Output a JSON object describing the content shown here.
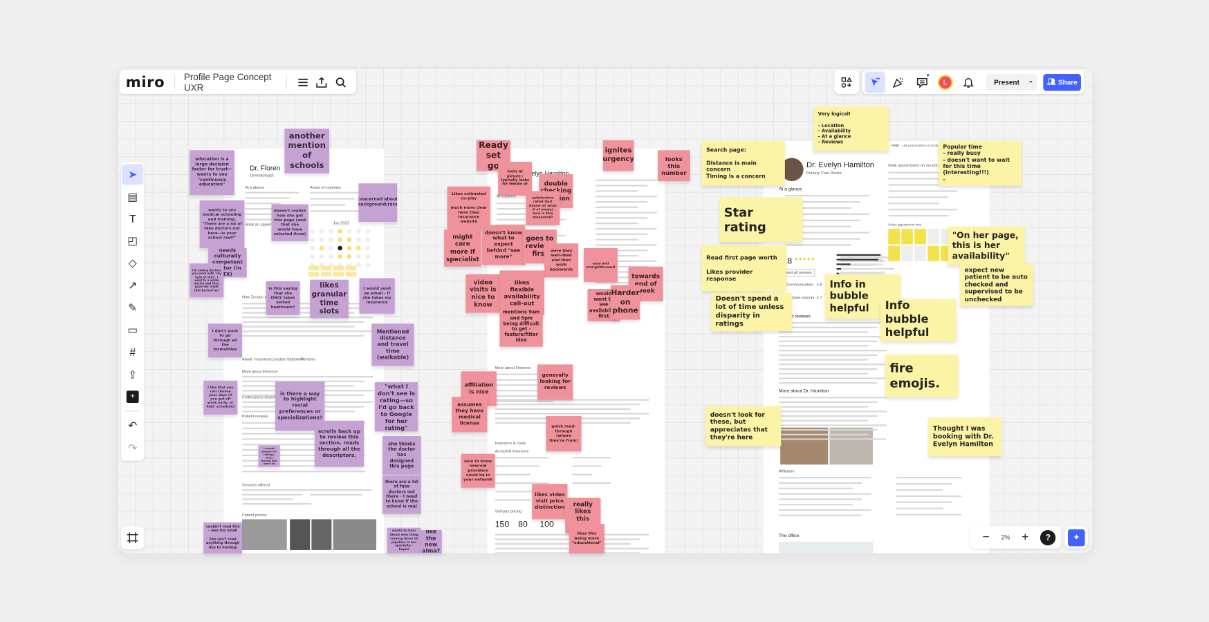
{
  "app": {
    "logo": "miro",
    "board_title": "Profile Page Concept UXR"
  },
  "top_right": {
    "present_label": "Present",
    "share_label": "Share",
    "avatar_initial": "L",
    "accent": "#4262ff",
    "avatar_color": "#f24e5b"
  },
  "zoom": {
    "level": "2%",
    "minus": "−",
    "plus": "+",
    "help": "?"
  },
  "left_tools": [
    "select-icon",
    "templates-icon",
    "text-icon",
    "sticky-note-icon",
    "shapes-icon",
    "arrow-icon",
    "pen-icon",
    "comment-icon",
    "frame-icon",
    "upload-icon",
    "add-icon",
    "undo-icon",
    "redo-icon"
  ],
  "colors": {
    "purple_sticky": "#c6a2d4",
    "pink_sticky": "#ef929b",
    "yellow_sticky": "#fbf3a5"
  },
  "mockups": {
    "page1": {
      "name": "Dr. Floren",
      "specialty": "Dermatologist",
      "sections": [
        "At a glance",
        "Areas of expertise",
        "Book an appointment",
        "How Zocdoc works",
        "More about Florence",
        "Professional statement",
        "Patient reviews",
        "Services offered",
        "Patient photos"
      ],
      "tabs": [
        "About",
        "Insurance",
        "Location",
        "Statement",
        "Reviews"
      ],
      "calendar_month": "Jun 2023"
    },
    "page2": {
      "name": "Evelyn Hamilton",
      "sections": [
        "At a glance",
        "More about Florence",
        "Insurance & costs",
        "Accepted insurance",
        "Self-pay pricing"
      ],
      "prices": [
        "150",
        "80",
        "100"
      ]
    },
    "page3": {
      "name": "Dr. Evelyn Hamilton",
      "specialty": "Primary Care Doctor",
      "at_a_glance": "At a glance",
      "book": "Book appointment on Zocdoc",
      "rating": "4.8",
      "read_reviews": "Read all reviews",
      "communication": "Communication",
      "communication_score": "4.8",
      "bedside": "Bedside manner",
      "bedside_score": "4.7",
      "recent_reviews": "Recent reviews",
      "more_about": "More about Dr. Hamilton",
      "affiliation": "Affiliation",
      "office": "The office",
      "help": "Help",
      "list_practice": "List your practice on Zocdoc",
      "select_time": "Select appointment time"
    }
  },
  "stickies": [
    {
      "color": "purple",
      "text": "education is a large decision factor for trust—wants to see \"continuous education\""
    },
    {
      "color": "purple",
      "text": "another mention of schools"
    },
    {
      "color": "purple",
      "text": "concerned about background/race"
    },
    {
      "color": "purple",
      "text": "wants to see medical schooling and training. \"There are a lot of fake doctors out here—is your school real?\""
    },
    {
      "color": "purple",
      "text": "doesn't realize how she got this page (and that she would have selected Acne)"
    },
    {
      "color": "purple",
      "text": "needs culturally competent doctor (in TX)"
    },
    {
      "color": "purple",
      "text": "I'm seeing doctors you work with \"my type of skin\". I went to a white doctor and they gave her made that burned her"
    },
    {
      "color": "purple",
      "text": "is this saying that she ONLY takes united heathcare?"
    },
    {
      "color": "purple",
      "text": "likes granular time slots"
    },
    {
      "color": "purple",
      "text": "I would send an email - if she takes my insurance"
    },
    {
      "color": "purple",
      "text": "I don't want to go through all the formalities"
    },
    {
      "color": "purple",
      "text": "Mentioned distance and travel time (walkable)"
    },
    {
      "color": "purple",
      "text": "I like that you can choose your days (if you get off work early, or kids' schedule)"
    },
    {
      "color": "purple",
      "text": "is there a way to highlight racial preferences or specializations?"
    },
    {
      "color": "purple",
      "text": "scrolls back up to review this section. reads through all the descriptors."
    },
    {
      "color": "purple",
      "text": "\"what I don't see is rating—so I'd go back to Google for her rating\""
    },
    {
      "color": "purple",
      "text": "I would google for ratings, what school she went to"
    },
    {
      "color": "purple",
      "text": "she thinks the doctor has designed this page"
    },
    {
      "color": "purple",
      "text": "there are a lot of fake doctors out there - I need to know if the school is real"
    },
    {
      "color": "purple",
      "text": "couldn't read this - was too small\n\nshe can't read anything through due to mockup"
    },
    {
      "color": "purple",
      "text": "wants to hear about new thing coming down th pipeline in her specialty - hopes"
    },
    {
      "color": "purple",
      "text": "like the new alma?"
    },
    {
      "color": "pink",
      "text": "Ready set go"
    },
    {
      "color": "pink",
      "text": "looks at picture / typically looks for female dr"
    },
    {
      "color": "pink",
      "text": "double checking location"
    },
    {
      "color": "pink",
      "text": "satisfaction rated (but based on what # of views) how is this measured?"
    },
    {
      "color": "pink",
      "text": "Likes estimated co-play\n\nmuch more clear here than insurance website"
    },
    {
      "color": "pink",
      "text": "ignites urgency"
    },
    {
      "color": "pink",
      "text": "looks this number"
    },
    {
      "color": "pink",
      "text": "might care more if specialist"
    },
    {
      "color": "pink",
      "text": "doesn't know what to expect behind \"see more\""
    },
    {
      "color": "pink",
      "text": "goes to reviews first"
    },
    {
      "color": "pink",
      "text": "were they well-liked and then work backwards"
    },
    {
      "color": "pink",
      "text": "easy and straightforward"
    },
    {
      "color": "pink",
      "text": "towards end of week"
    },
    {
      "color": "pink",
      "text": "video visits is nice to know"
    },
    {
      "color": "pink",
      "text": "likes flexible availability call-out"
    },
    {
      "color": "pink",
      "text": "would want to see availability first"
    },
    {
      "color": "pink",
      "text": "Harder on phone"
    },
    {
      "color": "pink",
      "text": "mentions 9am and 5pm being difficult to get - feature/filter idea"
    },
    {
      "color": "pink",
      "text": "affiliation is nice"
    },
    {
      "color": "pink",
      "text": "assumes they have medical license"
    },
    {
      "color": "pink",
      "text": "generally looking for reviews"
    },
    {
      "color": "pink",
      "text": "quick read-through (where they're from)"
    },
    {
      "color": "pink",
      "text": "nice to know new/old providers could be in your network"
    },
    {
      "color": "pink",
      "text": "likes video visit price distinction"
    },
    {
      "color": "pink",
      "text": "really likes this section"
    },
    {
      "color": "pink",
      "text": "likes this being more \"educational\""
    },
    {
      "color": "yellow",
      "text": "Very logical!\n\n- Location\n- Availability\n- At a glance\n- Reviews"
    },
    {
      "color": "yellow",
      "text": "Search page:\n\nDistance is main concern\nTiming is a concern"
    },
    {
      "color": "yellow",
      "text": "Popular time\n- really busy\n- doesn't want to wait for this time (interesting!!!)\n-"
    },
    {
      "color": "yellow",
      "text": "Star rating"
    },
    {
      "color": "yellow",
      "text": "Read first page worth\n\nLikes provider response"
    },
    {
      "color": "yellow",
      "text": "Doesn't spend a lot of time unless disparity in ratings"
    },
    {
      "color": "yellow",
      "text": "\"On her page, this is her availability\""
    },
    {
      "color": "yellow",
      "text": "expect new patient to be auto checked and supervised to be unchecked"
    },
    {
      "color": "yellow",
      "text": "Info in bubble helpful"
    },
    {
      "color": "yellow",
      "text": "Info bubble helpful"
    },
    {
      "color": "yellow",
      "text": "fire emojis."
    },
    {
      "color": "yellow",
      "text": "doesn't look for these, but appreciates that they're here"
    },
    {
      "color": "yellow",
      "text": "Thought I was booking with Dr. Evelyn Hamilton"
    }
  ]
}
